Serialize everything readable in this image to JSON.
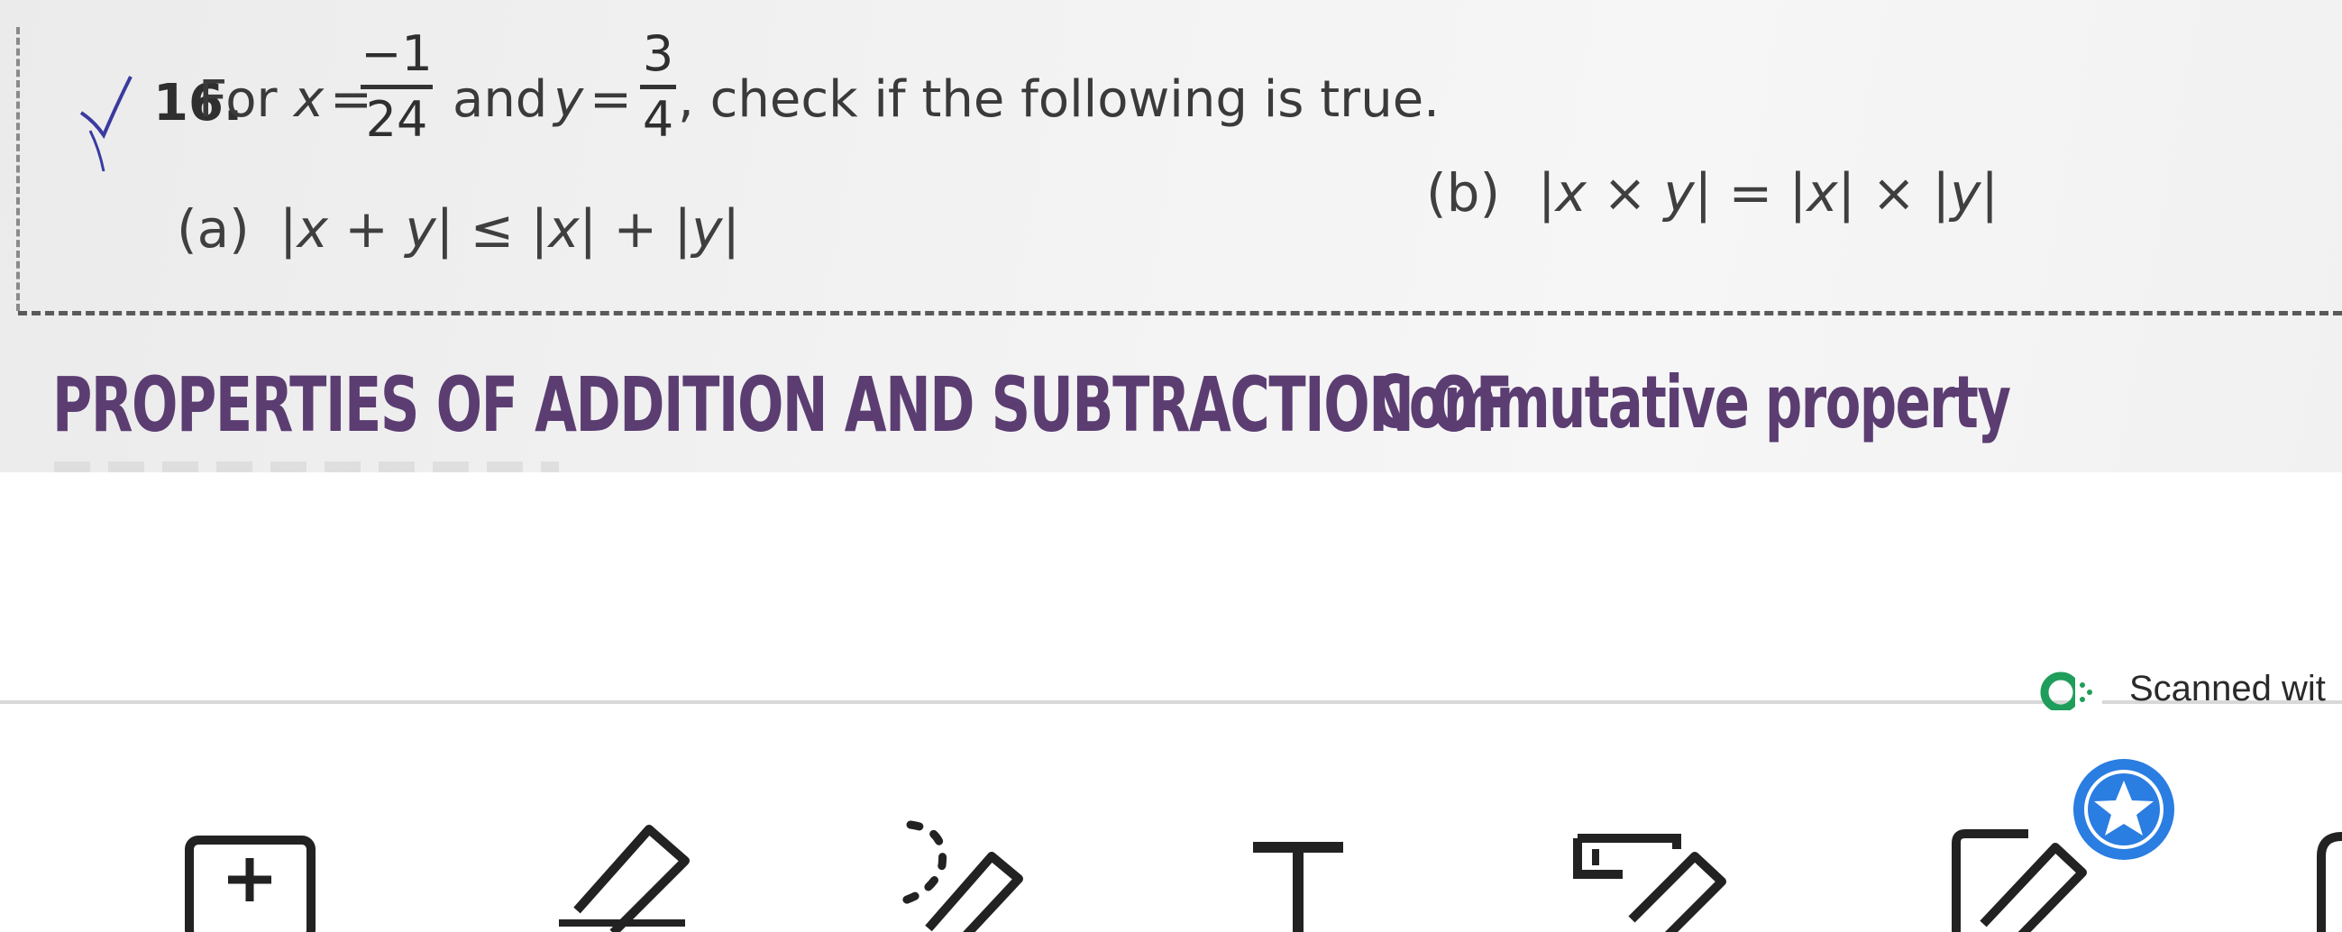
{
  "question": {
    "number": "16.",
    "prefix": "For",
    "x_var": "x",
    "eq1": "=",
    "x_num": "−1",
    "x_den": "24",
    "and": "and",
    "y_var": "y",
    "eq2": "=",
    "y_num": "3",
    "y_den": "4",
    "suffix": ", check if the following is true.",
    "option_a_label": "(a)",
    "option_a_expr": "|x + y| ≤ |x| + |y|",
    "option_b_label": "(b)",
    "option_b_expr": "|x × y| = |x| × |y|"
  },
  "headings": {
    "left": "PROPERTIES OF ADDITION AND SUBTRACTION OF",
    "right": "Commutative property"
  },
  "watermark": {
    "text": "Scanned wit"
  },
  "toolbar": {
    "tools": [
      {
        "icon": "add-box-icon"
      },
      {
        "icon": "highlighter-icon"
      },
      {
        "icon": "lasso-pen-icon"
      },
      {
        "icon": "text-icon"
      },
      {
        "icon": "eraser-icon"
      },
      {
        "icon": "edit-document-icon"
      }
    ],
    "badge_icon": "star-icon",
    "accent": "#2a7de1"
  }
}
